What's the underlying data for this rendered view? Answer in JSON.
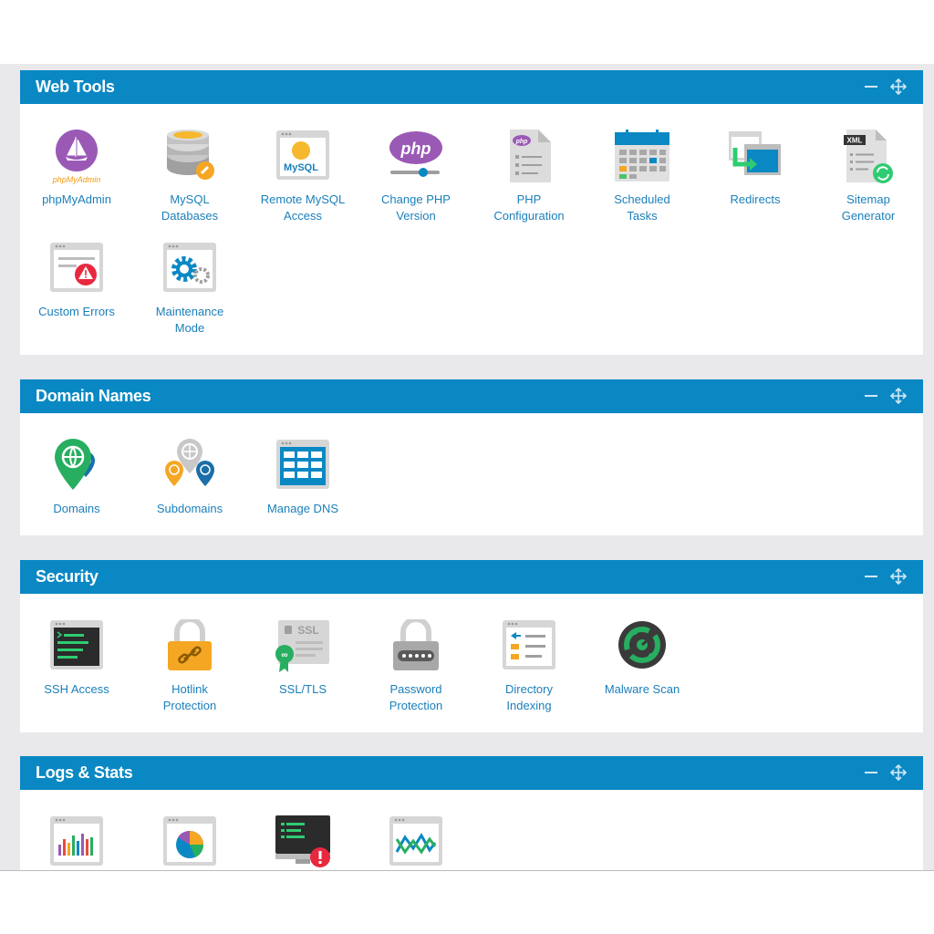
{
  "sections": [
    {
      "title": "Web Tools",
      "tools": [
        {
          "label": "phpMyAdmin",
          "icon": "phpmyadmin-icon"
        },
        {
          "label": "MySQL\nDatabases",
          "icon": "mysql-databases-icon"
        },
        {
          "label": "Remote MySQL\nAccess",
          "icon": "remote-mysql-icon",
          "icon_text": "MySQL"
        },
        {
          "label": "Change PHP\nVersion",
          "icon": "change-php-icon",
          "icon_text": "php"
        },
        {
          "label": "PHP\nConfiguration",
          "icon": "php-configuration-icon",
          "icon_text": "php"
        },
        {
          "label": "Scheduled\nTasks",
          "icon": "calendar-icon"
        },
        {
          "label": "Redirects",
          "icon": "redirect-icon"
        },
        {
          "label": "Sitemap\nGenerator",
          "icon": "sitemap-icon",
          "icon_text": "XML"
        },
        {
          "label": "Custom Errors",
          "icon": "custom-errors-icon"
        },
        {
          "label": "Maintenance\nMode",
          "icon": "maintenance-icon"
        }
      ]
    },
    {
      "title": "Domain Names",
      "tools": [
        {
          "label": "Domains",
          "icon": "domains-icon"
        },
        {
          "label": "Subdomains",
          "icon": "subdomains-icon"
        },
        {
          "label": "Manage DNS",
          "icon": "dns-icon"
        }
      ]
    },
    {
      "title": "Security",
      "tools": [
        {
          "label": "SSH Access",
          "icon": "terminal-icon"
        },
        {
          "label": "Hotlink\nProtection",
          "icon": "hotlink-lock-icon"
        },
        {
          "label": "SSL/TLS",
          "icon": "ssl-certificate-icon",
          "icon_text": "SSL"
        },
        {
          "label": "Password\nProtection",
          "icon": "password-lock-icon"
        },
        {
          "label": "Directory\nIndexing",
          "icon": "directory-indexing-icon"
        },
        {
          "label": "Malware Scan",
          "icon": "malware-scan-icon"
        }
      ]
    },
    {
      "title": "Logs & Stats",
      "tools": [
        {
          "label": "",
          "icon": "bar-stats-icon"
        },
        {
          "label": "",
          "icon": "pie-chart-icon"
        },
        {
          "label": "",
          "icon": "error-log-icon"
        },
        {
          "label": "",
          "icon": "line-graph-icon"
        }
      ]
    }
  ],
  "colors": {
    "header": "#0a88c4",
    "link": "#1a7fba",
    "background": "#e9e8ea"
  }
}
